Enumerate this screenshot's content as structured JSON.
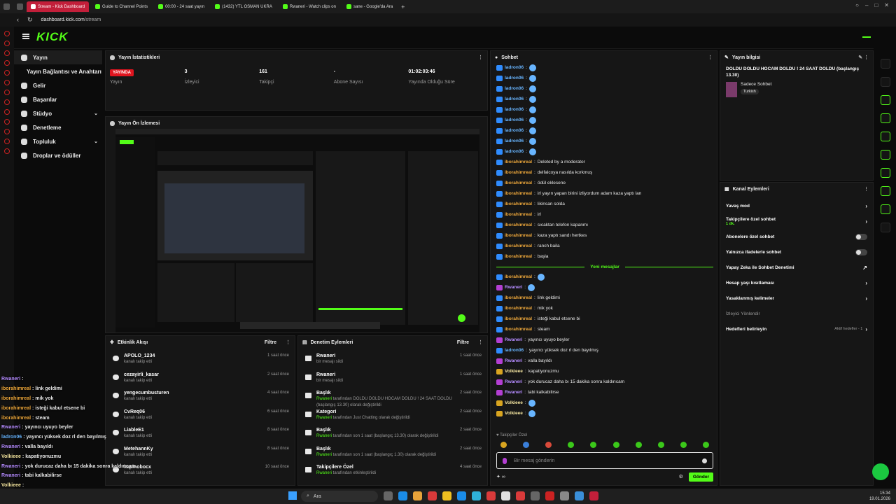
{
  "browser": {
    "tabs": [
      {
        "label": "Stream - Kick Dashboard",
        "active": true
      },
      {
        "label": "Guide to Channel Points"
      },
      {
        "label": "00:00 - 24 saat yayın"
      },
      {
        "label": "(1432) YTL OSMAN UKRA"
      },
      {
        "label": "Rwaneri - Watch clips on"
      },
      {
        "label": "sane - Google'da Ara"
      }
    ],
    "url_host": "dashboard.kick.com",
    "url_path": "/stream",
    "new_tab": "+"
  },
  "logo": "KICK",
  "sidebar": {
    "items": [
      {
        "label": "Yayın",
        "active": true
      },
      {
        "label": "Yayın Bağlantısı ve Anahtarı",
        "sub": true
      },
      {
        "label": "Gelir"
      },
      {
        "label": "Başarılar"
      },
      {
        "label": "Stüdyo",
        "chev": "⌄"
      },
      {
        "label": "Denetleme"
      },
      {
        "label": "Topluluk",
        "chev": "⌄"
      },
      {
        "label": "Droplar ve ödüller"
      }
    ]
  },
  "stats": {
    "title": "Yayın İstatistikleri",
    "live_badge": "YAYINDA",
    "items": [
      {
        "value": "",
        "label": "Yayın"
      },
      {
        "value": "3",
        "label": "İzleyici"
      },
      {
        "value": "161",
        "label": "Takipçi"
      },
      {
        "value": "-",
        "label": "Abone Sayısı"
      },
      {
        "value": "01:02:03:46",
        "label": "Yayında Olduğu Süre"
      }
    ]
  },
  "preview": {
    "title": "Yayın Ön İzlemesi"
  },
  "activity": {
    "title": "Etkinlik Akışı",
    "filter": "Filtre",
    "rows": [
      {
        "name": "APOLO_1234",
        "desc": "kanalı takip etti",
        "time": "1 saat önce"
      },
      {
        "name": "cezayirli_kasar",
        "desc": "kanalı takip etti",
        "time": "2 saat önce"
      },
      {
        "name": "yengecumbusturen",
        "desc": "kanalı takip etti",
        "time": "4 saat önce"
      },
      {
        "name": "CvReq06",
        "desc": "kanalı takip etti",
        "time": "6 saat önce"
      },
      {
        "name": "LiableE1",
        "desc": "kanalı takip etti",
        "time": "8 saat önce"
      },
      {
        "name": "MetehannKy",
        "desc": "kanalı takip etti",
        "time": "8 saat önce"
      },
      {
        "name": "kapinobocx",
        "desc": "kanalı takip etti",
        "time": "10 saat önce"
      }
    ]
  },
  "modlog": {
    "title": "Denetim Eylemleri",
    "filter": "Filtre",
    "rows": [
      {
        "title": "Rwaneri",
        "actor": "",
        "text": "bir mesajı sildi",
        "time": "1 saat önce"
      },
      {
        "title": "Rwaneri",
        "actor": "",
        "text": "bir mesajı sildi",
        "time": "1 saat önce"
      },
      {
        "title": "Başlık",
        "actor": "Rwaneri",
        "text": " tarafından DOLDU DOLDU HOCAM DOLDU ! 24 SAAT DOLDU (başlangıç 13.30) olarak değiştirildi",
        "time": "2 saat önce"
      },
      {
        "title": "Kategori",
        "actor": "Rwaneri",
        "text": " tarafından Just Chatting olarak değiştirildi",
        "time": "2 saat önce"
      },
      {
        "title": "Başlık",
        "actor": "Rwaneri",
        "text": " tarafından son 1 saat (başlangıç 13.30) olarak değiştirildi",
        "time": "2 saat önce"
      },
      {
        "title": "Başlık",
        "actor": "Rwaneri",
        "text": " tarafından son 1 saat (başlangıç 1.30) olarak değiştirildi",
        "time": "2 saat önce"
      },
      {
        "title": "Takipçilere Özel",
        "actor": "Rwaneri",
        "text": " tarafından etkinleştirildi",
        "time": "4 saat önce"
      }
    ]
  },
  "chat": {
    "title": "Sohbet",
    "new_messages": "Yeni mesajlar",
    "before": [
      {
        "user": "ladron06",
        "text": "",
        "color": "#68b5ff"
      },
      {
        "user": "ladron06",
        "text": "",
        "color": "#68b5ff"
      },
      {
        "user": "ladron06",
        "text": "",
        "color": "#68b5ff"
      },
      {
        "user": "ladron06",
        "text": "",
        "color": "#68b5ff"
      },
      {
        "user": "ladron06",
        "text": "",
        "color": "#68b5ff"
      },
      {
        "user": "ladron06",
        "text": "",
        "color": "#68b5ff"
      },
      {
        "user": "ladron06",
        "text": "",
        "color": "#68b5ff"
      },
      {
        "user": "ladron06",
        "text": "",
        "color": "#68b5ff"
      },
      {
        "user": "ladron06",
        "text": "",
        "color": "#68b5ff"
      },
      {
        "user": "iborahimreal",
        "text": "Deleted by a moderator",
        "color": "#f0a93b"
      },
      {
        "user": "iborahimreal",
        "text": "delfalcoya nasılda korkmuş",
        "color": "#f0a93b"
      },
      {
        "user": "iborahimreal",
        "text": "ödül eklesene",
        "color": "#f0a93b"
      },
      {
        "user": "iborahimreal",
        "text": "irl yayın yapan birini izliyordum adam kaza yaptı lan",
        "color": "#f0a93b"
      },
      {
        "user": "iborahimreal",
        "text": "likinsan solda",
        "color": "#f0a93b"
      },
      {
        "user": "iborahimreal",
        "text": "irl",
        "color": "#f0a93b"
      },
      {
        "user": "iborahimreal",
        "text": "sıcaktan telefon kapanmı",
        "color": "#f0a93b"
      },
      {
        "user": "iborahimreal",
        "text": "kaza yaptı sandı hertkes",
        "color": "#f0a93b"
      },
      {
        "user": "iborahimreal",
        "text": "ranch baila",
        "color": "#f0a93b"
      },
      {
        "user": "iborahimreal",
        "text": "başla",
        "color": "#f0a93b"
      }
    ],
    "after": [
      {
        "user": "iborahimreal",
        "text": "",
        "color": "#f0a93b"
      },
      {
        "user": "Rwaneri",
        "text": "",
        "color": "#b58cff"
      },
      {
        "user": "iborahimreal",
        "text": "link geldimi",
        "color": "#f0a93b"
      },
      {
        "user": "iborahimreal",
        "text": "mik yok",
        "color": "#f0a93b"
      },
      {
        "user": "iborahimreal",
        "text": "isteği kabul etsene bi",
        "color": "#f0a93b"
      },
      {
        "user": "iborahimreal",
        "text": "steam",
        "color": "#f0a93b"
      },
      {
        "user": "Rwaneri",
        "text": "yayıncı uyuyo beyler",
        "color": "#b58cff"
      },
      {
        "user": "ladron06",
        "text": "yayıncı yüksek doz rl den bayılmış",
        "color": "#68b5ff"
      },
      {
        "user": "Rwaneri",
        "text": "valla bayıldı",
        "color": "#b58cff"
      },
      {
        "user": "Volkieee",
        "text": "kapatiyonuzmu",
        "color": "#f5e6a0"
      },
      {
        "user": "Rwaneri",
        "text": "yok durucaz daha bı 15 dakika sonra kaldırıcam",
        "color": "#b58cff"
      },
      {
        "user": "Rwaneri",
        "text": "tabi kalkabilirse",
        "color": "#b58cff"
      },
      {
        "user": "Volkieee",
        "text": "",
        "color": "#f5e6a0"
      },
      {
        "user": "Volkieee",
        "text": "",
        "color": "#f5e6a0"
      }
    ],
    "follower_only": "Takipçiler Özel",
    "placeholder": "Bir mesaj gönderin",
    "send": "Gönder"
  },
  "info": {
    "title": "Yayın bilgisi",
    "stream_title": "DOLDU DOLDU HOCAM DOLDU ! 24 SAAT DOLDU (başlangıç 13.30)",
    "category": "Sadece Sohbet",
    "tag": "Turkish"
  },
  "actions": {
    "title": "Kanal Eylemleri",
    "items": [
      {
        "label": "Yavaş mod",
        "type": "chev"
      },
      {
        "label": "Takipçilere özel sohbet",
        "sub": "1 dk.",
        "type": "chev"
      },
      {
        "label": "Abonelere özel sohbet",
        "type": "toggle"
      },
      {
        "label": "Yalnızca ifadelerle sohbet",
        "type": "toggle"
      },
      {
        "label": "Yapay Zeka ile Sohbet Denetimi",
        "type": "ext"
      },
      {
        "label": "Hesap yaşı kısıtlaması",
        "type": "chev"
      },
      {
        "label": "Yasaklanmış kelimeler",
        "type": "chev"
      },
      {
        "label": "İzleyici Yönlendir",
        "type": "muted"
      },
      {
        "label": "Hedefleri belirleyin",
        "extra": "Aktif hedefler - 1",
        "type": "chev"
      }
    ]
  },
  "overlay": [
    {
      "user": "Rwaneri",
      "text": "",
      "color": "#b58cff"
    },
    {
      "user": "iborahimreal",
      "text": "link geldimi",
      "color": "#f0a93b"
    },
    {
      "user": "iborahimreal",
      "text": "mik yok",
      "color": "#f0a93b"
    },
    {
      "user": "iborahimreal",
      "text": "isteği kabul etsene bi",
      "color": "#f0a93b"
    },
    {
      "user": "iborahimreal",
      "text": "steam",
      "color": "#f0a93b"
    },
    {
      "user": "Rwaneri",
      "text": "yayıncı uyuyo beyler",
      "color": "#b58cff"
    },
    {
      "user": "ladron06",
      "text": "yayıncı yüksek doz rl den bayılmış",
      "color": "#68b5ff"
    },
    {
      "user": "Rwaneri",
      "text": "valla bayıldı",
      "color": "#b58cff"
    },
    {
      "user": "Volkieee",
      "text": "kapatiyonuzmu",
      "color": "#f5e6a0"
    },
    {
      "user": "Rwaneri",
      "text": "yok durucaz daha bı 15 dakika sonra kaldırıcam",
      "color": "#b58cff"
    },
    {
      "user": "Rwaneri",
      "text": "tabi kalkabilirse",
      "color": "#b58cff"
    },
    {
      "user": "Volkieee",
      "text": "",
      "color": "#f5e6a0"
    },
    {
      "user": "Volkieee",
      "text": "",
      "color": "#f5e6a0"
    }
  ],
  "taskbar": {
    "search": "Ara",
    "time": "15:34",
    "date": "19.01.2026"
  },
  "colors": {
    "accent": "#53fc18",
    "live": "#e0151f"
  }
}
